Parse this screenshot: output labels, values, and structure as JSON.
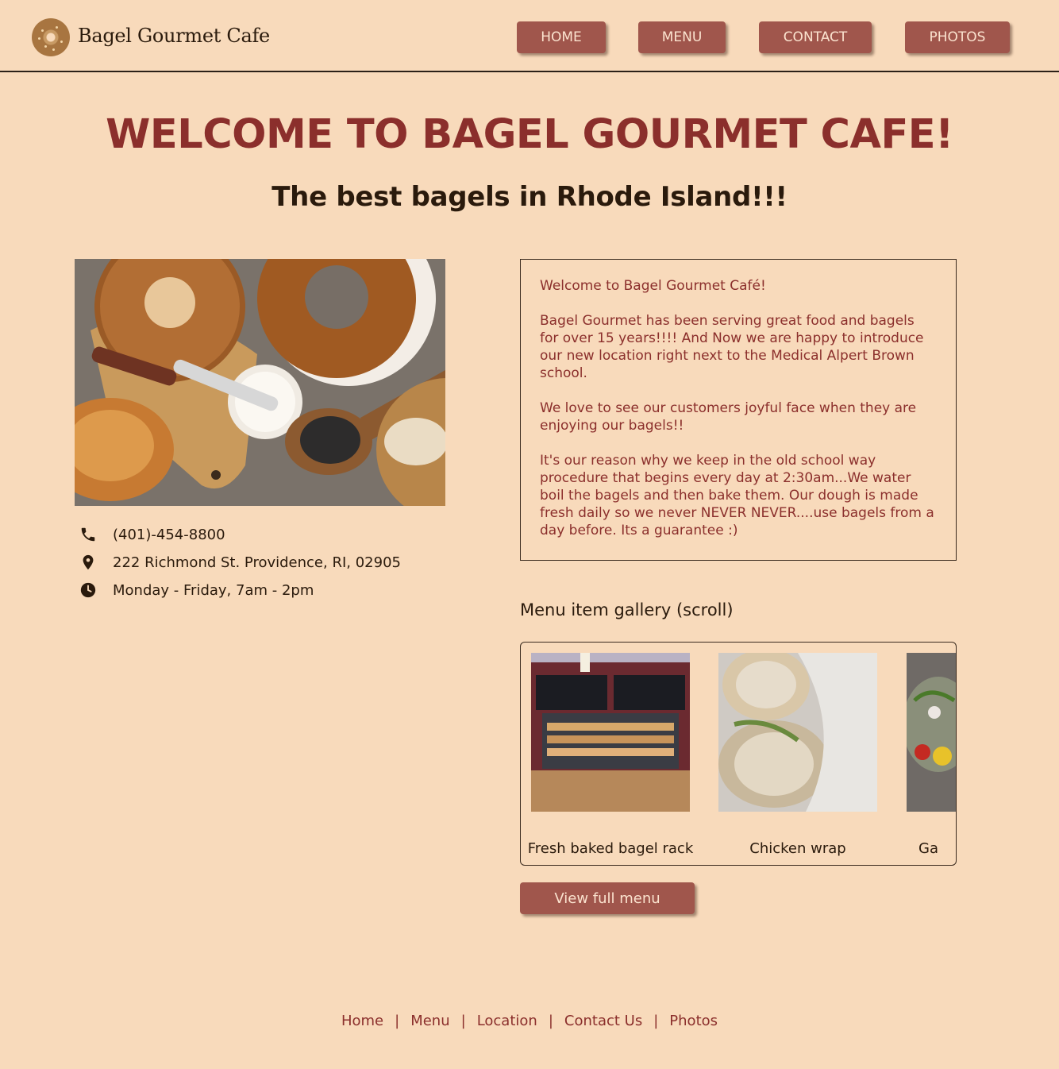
{
  "header": {
    "brand": "Bagel Gourmet Cafe",
    "nav": [
      "HOME",
      "MENU",
      "CONTACT",
      "PHOTOS"
    ]
  },
  "hero": {
    "title": "WELCOME TO BAGEL GOURMET CAFE!",
    "subtitle": "The best bagels in Rhode Island!!!"
  },
  "contact": {
    "phone": "(401)-454-8800",
    "address": "222 Richmond St. Providence, RI, 02905",
    "hours": "Monday - Friday, 7am - 2pm"
  },
  "about": {
    "paragraphs": [
      "Welcome to Bagel Gourmet Café!",
      "Bagel Gourmet has been serving great food and bagels for over 15 years!!!! And Now we are happy to introduce our new location right next to the Medical Alpert Brown school.",
      "We love to see our customers joyful face when they are enjoying our bagels!!",
      "It's our reason why we keep in the old school way procedure that begins every day at 2:30am...We water boil the bagels and then bake them. Our dough is made fresh daily so we never NEVER NEVER....use bagels from a day before.  Its a guarantee :)"
    ]
  },
  "gallery": {
    "heading": "Menu item gallery (scroll)",
    "items": [
      {
        "caption": "Fresh baked bagel rack"
      },
      {
        "caption": "Chicken wrap"
      },
      {
        "caption": "Ga"
      }
    ]
  },
  "menu_button": "View full menu",
  "footer": {
    "links": [
      "Home",
      "Menu",
      "Location",
      "Contact Us",
      "Photos"
    ],
    "separator": "|"
  },
  "colors": {
    "background": "#f8dabb",
    "accent": "#a0564c",
    "title": "#8b2f2c",
    "text": "#2a1a0c"
  }
}
